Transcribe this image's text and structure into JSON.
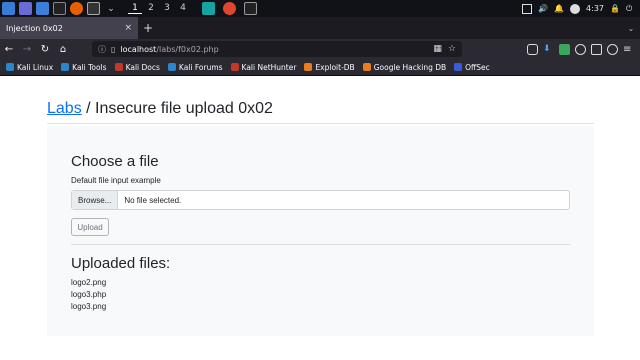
{
  "taskbar": {
    "workspaces": [
      "1",
      "2",
      "3",
      "4"
    ],
    "active_workspace": "1",
    "clock": "4:37"
  },
  "browser": {
    "tab_title": "Injection 0x02",
    "tab_close": "×",
    "new_tab": "+",
    "url_host": "localhost",
    "url_path": "/labs/f0x02.php"
  },
  "bookmarks": [
    {
      "label": "Kali Linux",
      "color": "#2d86c9"
    },
    {
      "label": "Kali Tools",
      "color": "#2d86c9"
    },
    {
      "label": "Kali Docs",
      "color": "#c0392b"
    },
    {
      "label": "Kali Forums",
      "color": "#2d86c9"
    },
    {
      "label": "Kali NetHunter",
      "color": "#c0392b"
    },
    {
      "label": "Exploit-DB",
      "color": "#e67e22"
    },
    {
      "label": "Google Hacking DB",
      "color": "#e67e22"
    },
    {
      "label": "OffSec",
      "color": "#3b5bdb"
    }
  ],
  "page": {
    "breadcrumb_link": "Labs",
    "breadcrumb_sep": " / ",
    "breadcrumb_current": "Insecure file upload 0x02",
    "choose_heading": "Choose a file",
    "input_label": "Default file input example",
    "browse_label": "Browse...",
    "no_file_text": "No file selected.",
    "upload_label": "Upload",
    "uploaded_heading": "Uploaded files:",
    "files": [
      "logo2.png",
      "logo3.php",
      "logo3.png"
    ]
  }
}
